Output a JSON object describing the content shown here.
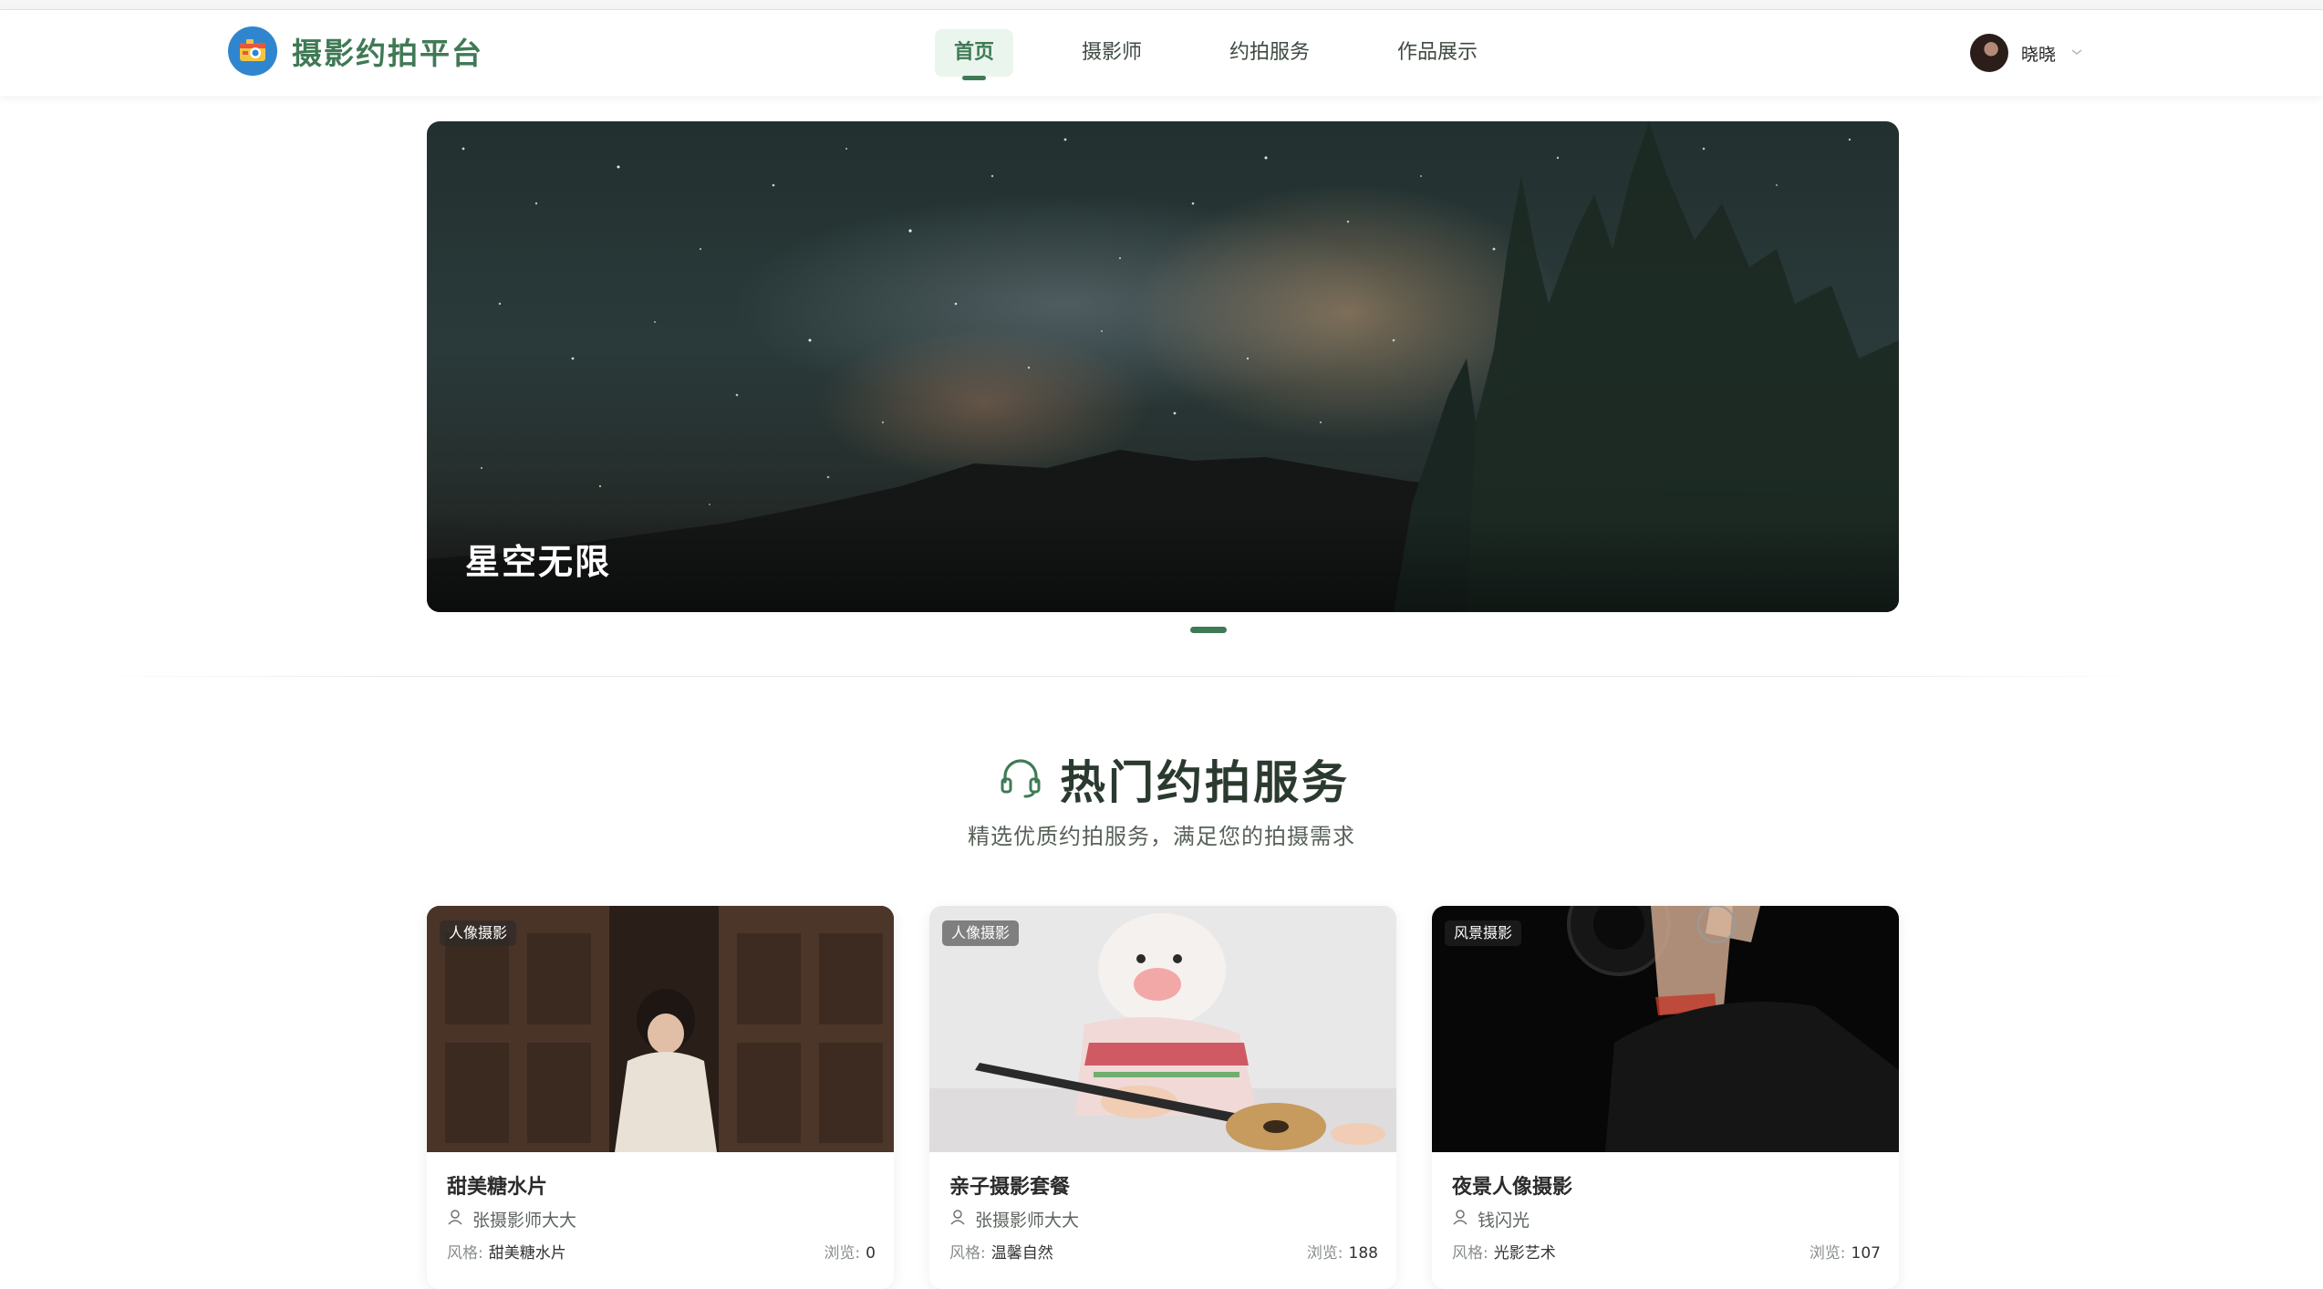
{
  "header": {
    "logo_text": "摄影约拍平台",
    "nav": [
      {
        "label": "首页",
        "active": true
      },
      {
        "label": "摄影师",
        "active": false
      },
      {
        "label": "约拍服务",
        "active": false
      },
      {
        "label": "作品展示",
        "active": false
      }
    ],
    "user_name": "晓晓"
  },
  "banner": {
    "title": "星空无限"
  },
  "section": {
    "title": "热门约拍服务",
    "subtitle": "精选优质约拍服务，满足您的拍摄需求"
  },
  "cards": [
    {
      "tag": "人像摄影",
      "title": "甜美糖水片",
      "author": "张摄影师大大",
      "style_label": "风格:",
      "style_value": "甜美糖水片",
      "views_label": "浏览:",
      "views_value": "0"
    },
    {
      "tag": "人像摄影",
      "title": "亲子摄影套餐",
      "author": "张摄影师大大",
      "style_label": "风格:",
      "style_value": "温馨自然",
      "views_label": "浏览:",
      "views_value": "188"
    },
    {
      "tag": "风景摄影",
      "title": "夜景人像摄影",
      "author": "钱闪光",
      "style_label": "风格:",
      "style_value": "光影艺术",
      "views_label": "浏览:",
      "views_value": "107"
    }
  ],
  "colors": {
    "accent": "#3f7a55",
    "nav_active_bg": "#eaf5ee"
  },
  "icons": {
    "logo": "camera-logo-icon",
    "section": "headset-icon",
    "author": "user-icon",
    "dropdown": "chevron-down-icon"
  }
}
